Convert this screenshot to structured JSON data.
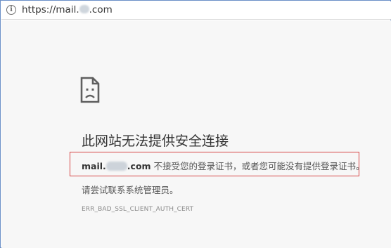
{
  "address_bar": {
    "url_prefix": "https://mail.",
    "url_suffix": ".com",
    "info_icon": "info-icon"
  },
  "error_page": {
    "icon": "sad-document-icon",
    "title": "此网站无法提供安全连接",
    "message_domain_prefix": "mail.",
    "message_domain_suffix": ".com",
    "message_text": " 不接受您的登录证书，或者您可能没有提供登录证书。",
    "advice": "请尝试联系系统管理员。",
    "error_code": "ERR_BAD_SSL_CLIENT_AUTH_CERT",
    "highlight_color": "#d64545"
  }
}
